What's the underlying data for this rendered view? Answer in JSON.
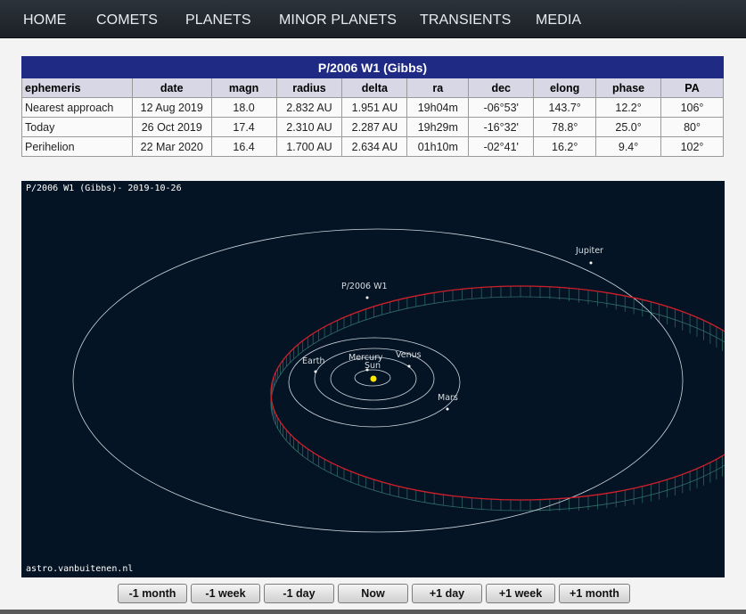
{
  "nav": {
    "items": [
      "HOME",
      "COMETS",
      "PLANETS",
      "MINOR PLANETS",
      "TRANSIENTS",
      "MEDIA"
    ]
  },
  "ephemeris": {
    "title": "P/2006 W1 (Gibbs)",
    "columns": [
      "ephemeris",
      "date",
      "magn",
      "radius",
      "delta",
      "ra",
      "dec",
      "elong",
      "phase",
      "PA"
    ],
    "rows": [
      [
        "Nearest approach",
        "12 Aug 2019",
        "18.0",
        "2.832 AU",
        "1.951 AU",
        "19h04m",
        "-06°53'",
        "143.7°",
        "12.2°",
        "106°"
      ],
      [
        "Today",
        "26 Oct 2019",
        "17.4",
        "2.310 AU",
        "2.287 AU",
        "19h29m",
        "-16°32'",
        "78.8°",
        "25.0°",
        "80°"
      ],
      [
        "Perihelion",
        "22 Mar 2020",
        "16.4",
        "1.700 AU",
        "2.634 AU",
        "01h10m",
        "-02°41'",
        "16.2°",
        "9.4°",
        "102°"
      ]
    ]
  },
  "orbit_plot": {
    "title": "P/2006 W1 (Gibbs)- 2019-10-26",
    "credit": "astro.vanbuitenen.nl",
    "labels": {
      "comet": "P/2006 W1",
      "jupiter": "Jupiter",
      "mercury": "Mercury",
      "venus": "Venus",
      "sun": "Sun",
      "earth": "Earth",
      "mars": "Mars"
    },
    "colors": {
      "background": "#051424",
      "planet_orbits": "#cfd6dd",
      "comet_orbit": "#d01f2a",
      "comet_hatching": "#2f6f68",
      "sun": "#ffe800"
    }
  },
  "controls": {
    "buttons": [
      "-1 month",
      "-1 week",
      "-1 day",
      "Now",
      "+1 day",
      "+1 week",
      "+1 month"
    ]
  }
}
